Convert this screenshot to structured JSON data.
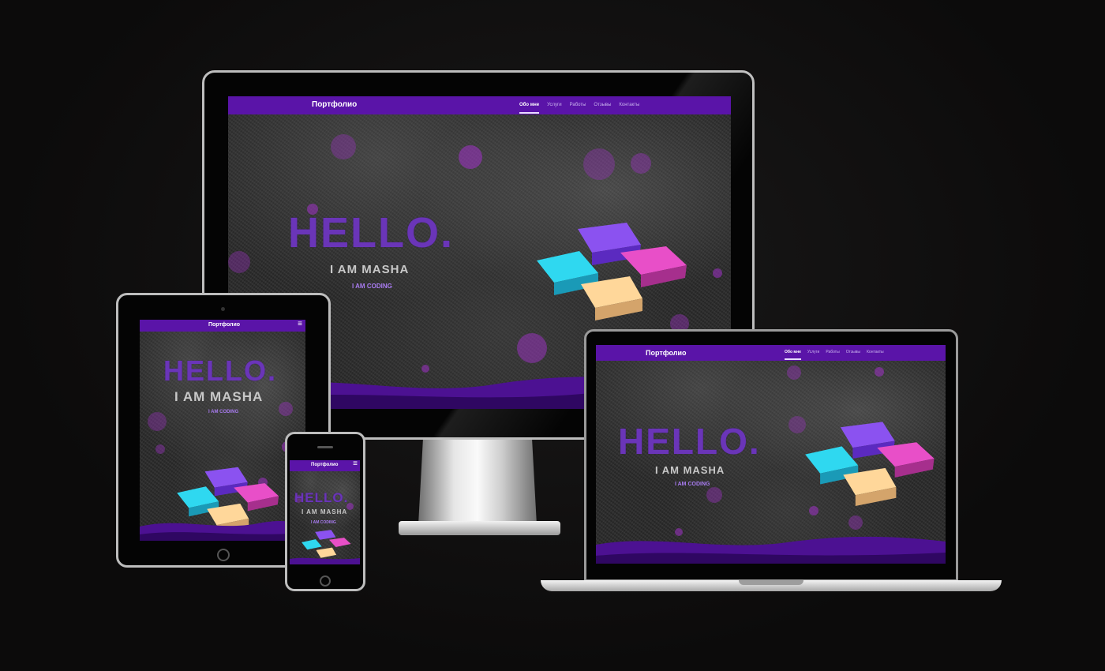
{
  "site": {
    "brand": "Портфолио",
    "menu": [
      "Обо мне",
      "Услуги",
      "Работы",
      "Отзывы",
      "Контакты"
    ],
    "hero_title": "HELLO.",
    "hero_name": "I AM MASHA",
    "hero_tagline": "I AM CODING"
  },
  "colors": {
    "background": "#0c0b0b",
    "nav": "#5a14a8",
    "accent": "#a87bf0",
    "puzzle_purple": "#8b52f0",
    "puzzle_cyan": "#2fd8f0",
    "puzzle_pink": "#e84fc8",
    "puzzle_peach": "#ffd79a"
  },
  "icons": {
    "menu": "hamburger-icon",
    "home_button": "home-button-icon",
    "illustration": "puzzle-pieces-icon"
  }
}
